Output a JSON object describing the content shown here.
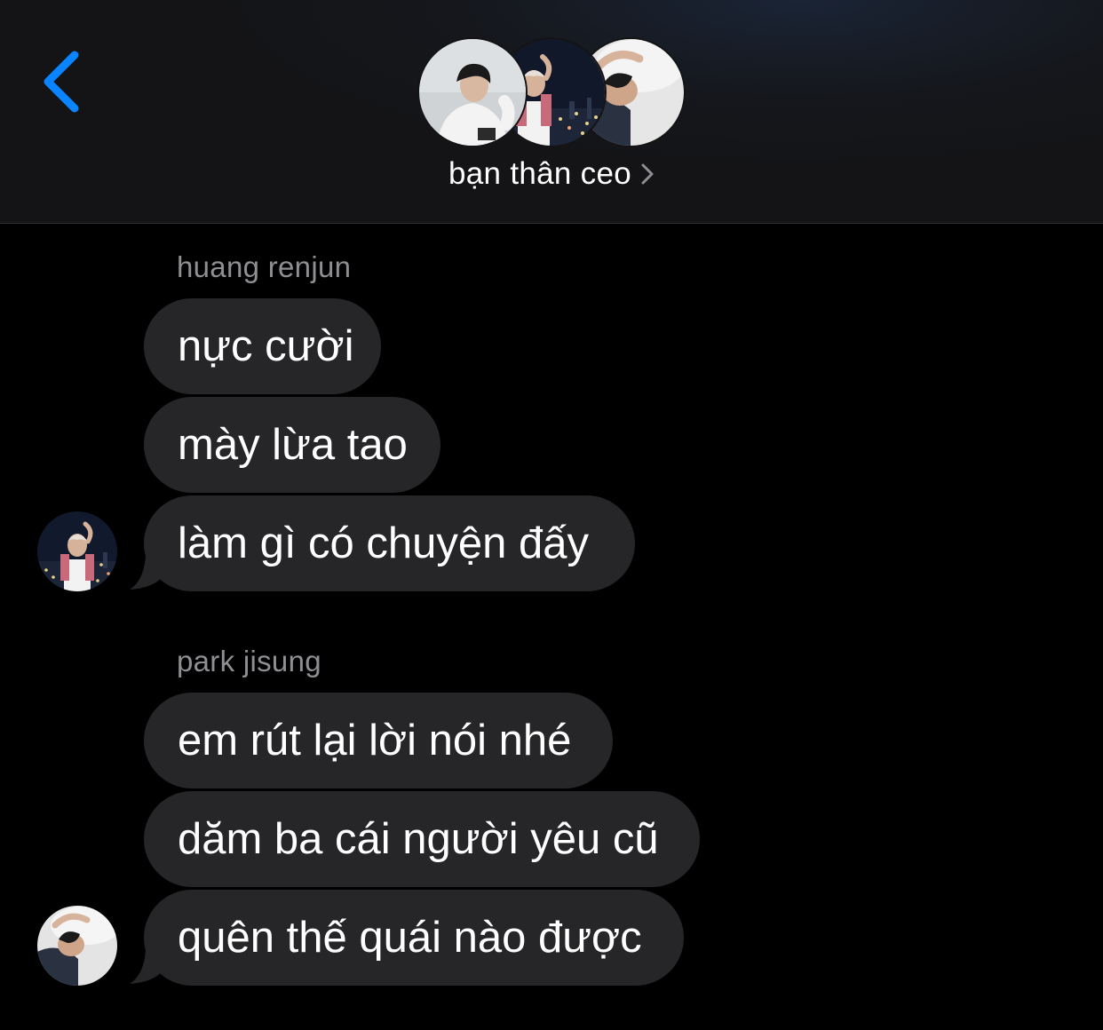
{
  "header": {
    "group_name": "bạn thân ceo",
    "back_icon": "chevron-left-icon",
    "accent_color": "#0a84ff"
  },
  "conversation": {
    "groups": [
      {
        "sender": "huang renjun",
        "messages": [
          "nực cười",
          "mày lừa tao",
          "làm gì có chuyện đấy"
        ]
      },
      {
        "sender": "park jisung",
        "messages": [
          "em rút lại lời nói nhé",
          "dăm ba cái người yêu cũ",
          "quên thế quái nào được"
        ]
      }
    ]
  }
}
